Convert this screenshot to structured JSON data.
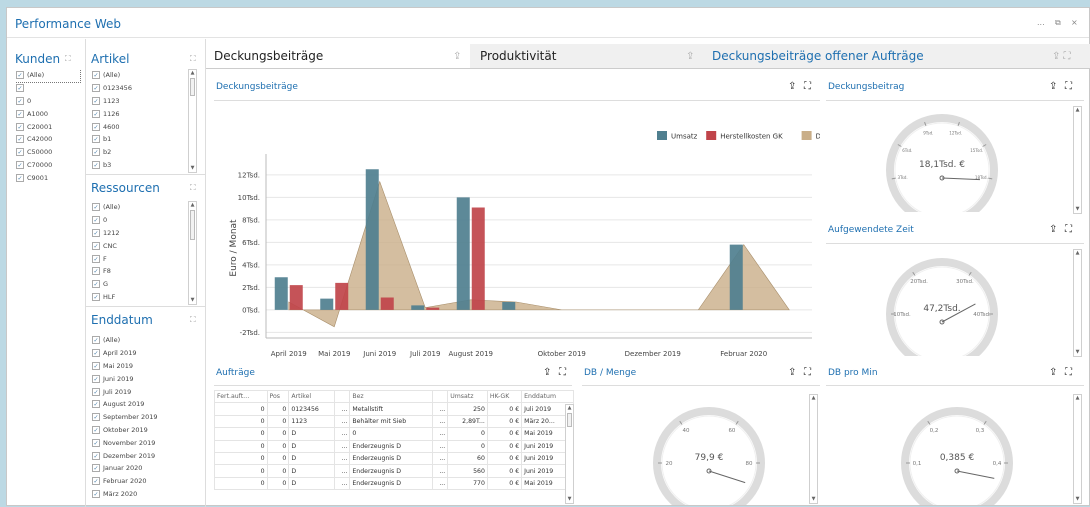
{
  "app": {
    "title": "Performance Web",
    "win_controls": [
      "...",
      "⧉",
      "×"
    ]
  },
  "kunden": {
    "title": "Kunden",
    "items": [
      "(Alle)",
      "",
      "0",
      "A1000",
      "C20001",
      "C42000",
      "C50000",
      "C70000",
      "C9001"
    ]
  },
  "artikel": {
    "title": "Artikel",
    "items": [
      "(Alle)",
      "0123456",
      "1123",
      "1126",
      "4600",
      "b1",
      "b2",
      "b3"
    ]
  },
  "ressourcen": {
    "title": "Ressourcen",
    "items": [
      "(Alle)",
      "0",
      "1212",
      "CNC",
      "F",
      "F8",
      "G",
      "HLF"
    ]
  },
  "enddatum": {
    "title": "Enddatum",
    "items": [
      "(Alle)",
      "April 2019",
      "Mai 2019",
      "Juni 2019",
      "Juli 2019",
      "August 2019",
      "September 2019",
      "Oktober 2019",
      "November 2019",
      "Dezember 2019",
      "Januar 2020",
      "Februar 2020",
      "März 2020"
    ]
  },
  "tabs": [
    "Deckungsbeiträge",
    "Produktivität",
    "Deckungsbeiträge offener Aufträge"
  ],
  "main_chart": {
    "title": "Deckungsbeiträge"
  },
  "chart_data": {
    "type": "bar",
    "ylabel": "Euro / Monat",
    "ylim": [
      -2500,
      13500
    ],
    "yticks": [
      "12Tsd.",
      "10Tsd.",
      "8Tsd.",
      "6Tsd.",
      "4Tsd.",
      "2Tsd.",
      "0Tsd.",
      "-2Tsd."
    ],
    "ytick_values": [
      12000,
      10000,
      8000,
      6000,
      4000,
      2000,
      0,
      -2000
    ],
    "grid": true,
    "legend": "top-right",
    "categories": [
      "2019-04",
      "2019-05",
      "2019-06",
      "2019-07",
      "2019-08",
      "2019-09",
      "2019-10",
      "2019-11",
      "2019-12",
      "2020-01",
      "2020-02",
      "2020-03"
    ],
    "xtick_labels": [
      {
        "i": 0,
        "label": "April 2019"
      },
      {
        "i": 1,
        "label": "Mai 2019"
      },
      {
        "i": 2,
        "label": "Juni 2019"
      },
      {
        "i": 3,
        "label": "Juli 2019"
      },
      {
        "i": 4,
        "label": "August 2019"
      },
      {
        "i": 6,
        "label": "Oktober 2019"
      },
      {
        "i": 8,
        "label": "Dezember 2019"
      },
      {
        "i": 10,
        "label": "Februar 2020"
      }
    ],
    "series": [
      {
        "name": "Umsatz",
        "color": "#4f7f8f",
        "values": [
          2900,
          1000,
          12500,
          400,
          10000,
          700,
          0,
          0,
          0,
          0,
          5800,
          0
        ]
      },
      {
        "name": "Herstellkosten GK",
        "color": "#c0444a",
        "values": [
          2200,
          2400,
          1100,
          200,
          9100,
          0,
          0,
          0,
          0,
          0,
          0,
          0
        ]
      },
      {
        "name": "DB",
        "color": "#c9ae88",
        "values": [
          700,
          -1500,
          11400,
          200,
          900,
          700,
          0,
          0,
          0,
          0,
          5800,
          0
        ]
      }
    ]
  },
  "deckungsbeitrag": {
    "title": "Deckungsbeitrag",
    "value": "18,1Tsd. €",
    "ticks": [
      "6Tsd.",
      "9Tsd.",
      "12Tsd.",
      "15Tsd.",
      "18Tsd.",
      "3Tsd."
    ],
    "needle_fraction": 0.92
  },
  "aufgewendete": {
    "title": "Aufgewendete Zeit",
    "value": "47,2Tsd.",
    "ticks": [
      "20Tsd.",
      "30Tsd.",
      "10Tsd.",
      "40Tsd."
    ],
    "needle_fraction": 0.78
  },
  "db_menge": {
    "title": "DB / Menge",
    "value": "79,9 €",
    "ticks": [
      "40",
      "60",
      "20",
      "80"
    ],
    "needle_fraction": 0.99
  },
  "db_min": {
    "title": "DB pro Min",
    "value": "0,385 €",
    "ticks": [
      "0,2",
      "0,3",
      "0,1",
      "0,4"
    ],
    "needle_fraction": 0.96
  },
  "auftraege": {
    "title": "Aufträge",
    "columns": [
      "Fert.auft…",
      "Pos",
      "Artikel",
      "",
      "Bez",
      "",
      "Umsatz",
      "HK-GK",
      "Enddatum"
    ],
    "rows": [
      [
        "0",
        "0",
        "0123456",
        "...",
        "Metallstift",
        "...",
        "250",
        "0 €",
        "Juli 2019"
      ],
      [
        "0",
        "0",
        "1123",
        "...",
        "Behälter mit Sieb",
        "...",
        "2,89T...",
        "0 €",
        "März 20..."
      ],
      [
        "0",
        "0",
        "D",
        "...",
        "0",
        "...",
        "0",
        "0 €",
        "Mai 2019"
      ],
      [
        "0",
        "0",
        "D",
        "...",
        "Enderzeugnis D",
        "...",
        "0",
        "0 €",
        "Juni 2019"
      ],
      [
        "0",
        "0",
        "D",
        "...",
        "Enderzeugnis D",
        "...",
        "60",
        "0 €",
        "Juni 2019"
      ],
      [
        "0",
        "0",
        "D",
        "...",
        "Enderzeugnis D",
        "...",
        "560",
        "0 €",
        "Juni 2019"
      ],
      [
        "0",
        "0",
        "D",
        "...",
        "Enderzeugnis D",
        "...",
        "770",
        "0 €",
        "Mai 2019"
      ]
    ]
  }
}
